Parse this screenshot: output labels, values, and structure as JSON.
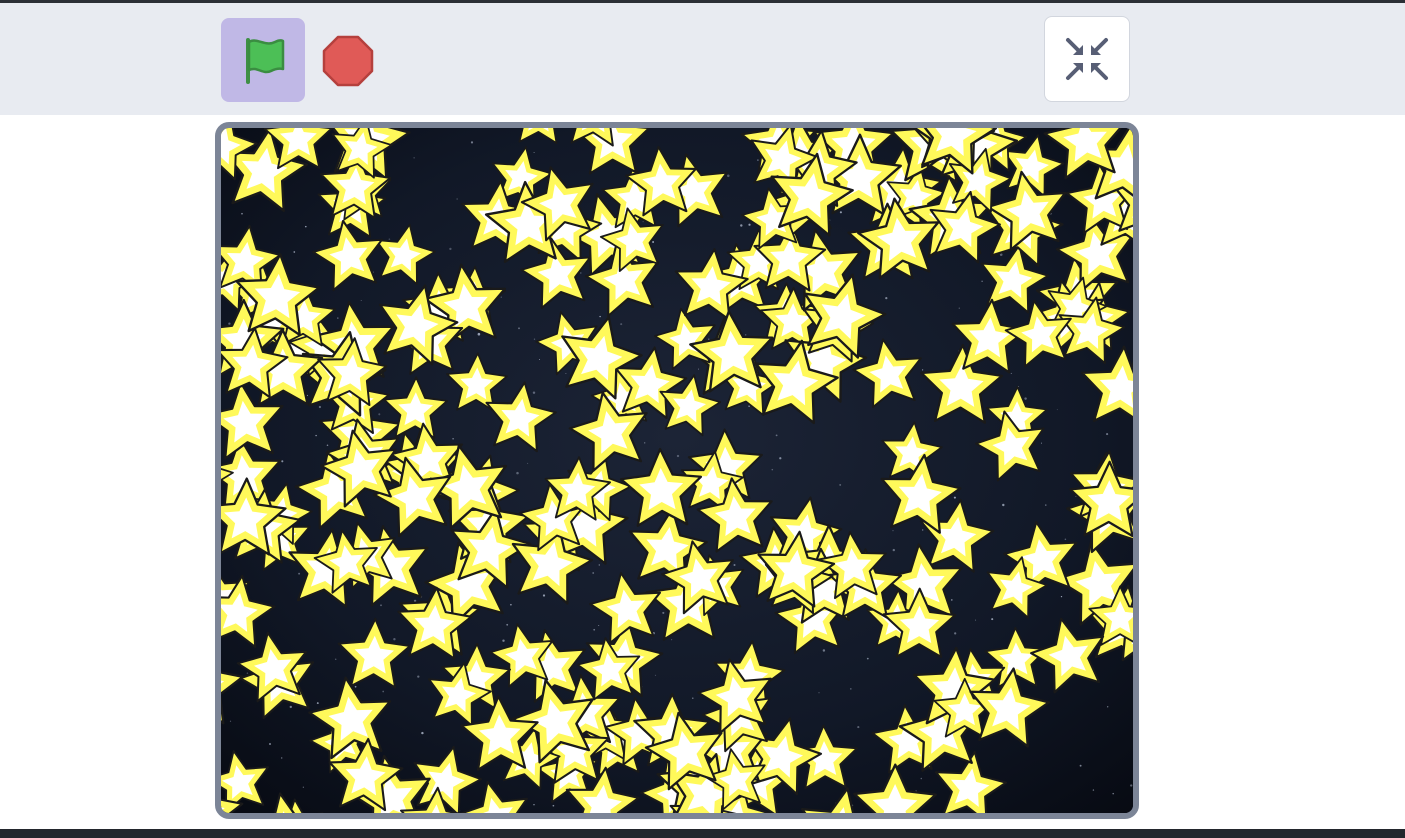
{
  "controls": {
    "green_flag": {
      "icon": "green-flag-icon",
      "color": "#4cbf56",
      "background": "#c0b8e6"
    },
    "stop": {
      "icon": "stop-sign-icon",
      "color": "#e05a57"
    },
    "screen_mode": {
      "icon": "shrink-arrows-icon",
      "color": "#575e75"
    }
  },
  "stage": {
    "backdrop": "night-sky",
    "sprite": "yellow-star",
    "colors": {
      "sky": "#0d1320",
      "star_fill": "#fff95a",
      "star_core": "#ffffff",
      "star_outline": "#1a1a1a",
      "frame": "#7c8597"
    }
  }
}
